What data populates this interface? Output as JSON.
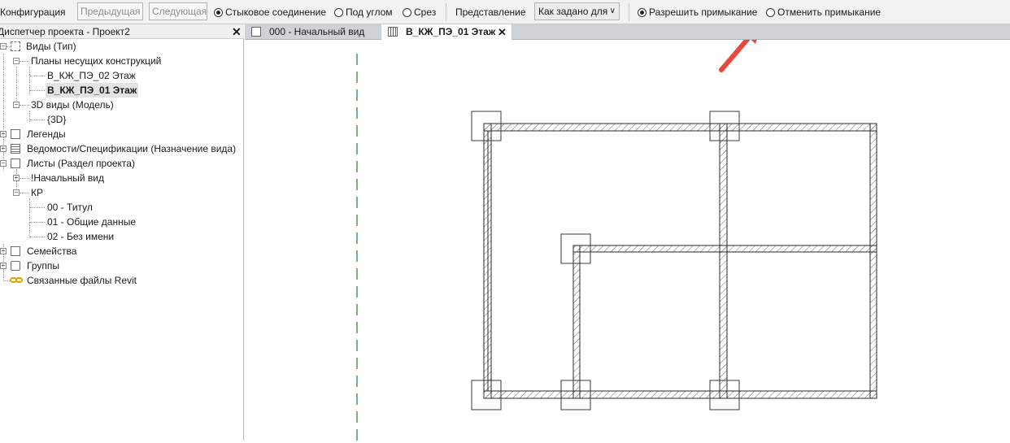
{
  "options_bar": {
    "config_label": "Конфигурация",
    "prev_button": "Предыдущая",
    "next_button": "Следующая",
    "radio_butt": "Стыковое соединение",
    "radio_angle": "Под углом",
    "radio_cut": "Срез",
    "display_label": "Представление",
    "display_select": "Как задано для",
    "allow_join": "Разрешить примыкание",
    "disallow_join": "Отменить примыкание",
    "selected_join_type": "Стыковое соединение",
    "selected_join_mode": "Разрешить примыкание"
  },
  "browser": {
    "title": "Диспетчер проекта - Проект2",
    "items": [
      {
        "label": "Виды (Тип)",
        "icon": "views-icon"
      },
      {
        "label": "Планы несущих конструкций"
      },
      {
        "label": "В_КЖ_ПЭ_02 Этаж"
      },
      {
        "label": "В_КЖ_ПЭ_01 Этаж",
        "selected": true
      },
      {
        "label": "3D виды (Модель)"
      },
      {
        "label": "{3D}"
      },
      {
        "label": "Легенды",
        "icon": "legend-icon"
      },
      {
        "label": "Ведомости/Спецификации (Назначение вида)",
        "icon": "schedule-icon"
      },
      {
        "label": "Листы (Раздел проекта)",
        "icon": "sheets-icon"
      },
      {
        "label": "!Начальный вид"
      },
      {
        "label": "КР"
      },
      {
        "label": "00 - Титул"
      },
      {
        "label": "01 - Общие данные"
      },
      {
        "label": "02 - Без имени"
      },
      {
        "label": "Семейства",
        "icon": "families-icon"
      },
      {
        "label": "Группы",
        "icon": "groups-icon"
      },
      {
        "label": "Связанные файлы Revit",
        "icon": "revit-links-icon"
      }
    ]
  },
  "tabs": [
    {
      "label": "000 - Начальный вид",
      "active": false
    },
    {
      "label": "В_КЖ_ПЭ_01 Этаж",
      "active": true
    }
  ],
  "colors": {
    "accent_arrow": "#e8473a",
    "grid_line": "#2e8b2e",
    "wall_line": "#2a2a2a"
  }
}
